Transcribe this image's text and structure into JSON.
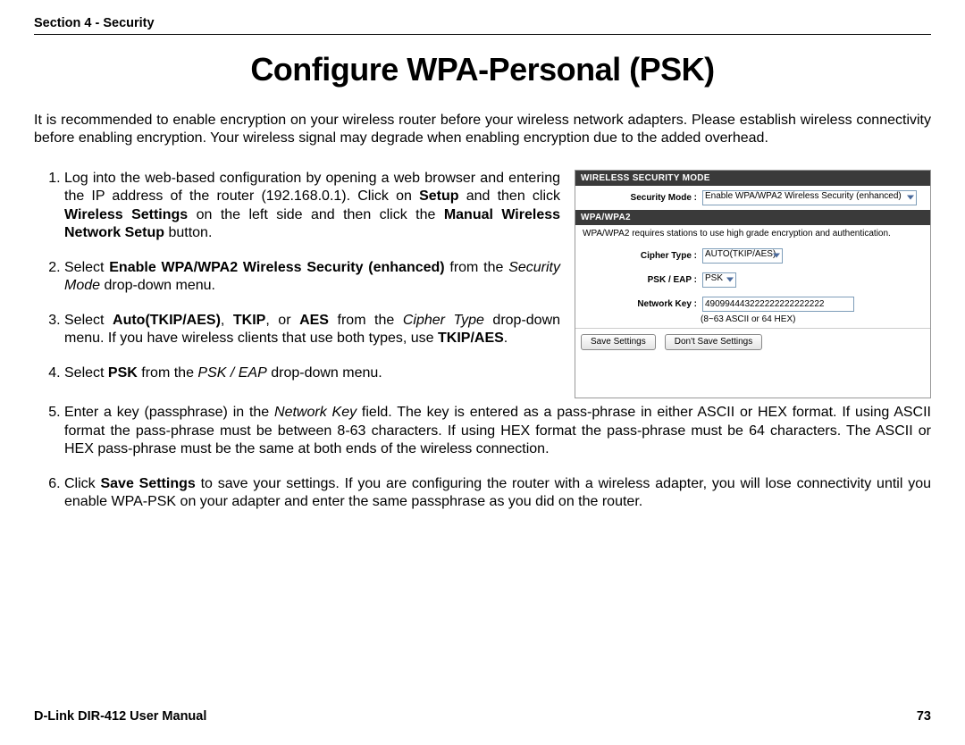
{
  "header": {
    "section": "Section 4 - Security"
  },
  "title": "Configure WPA-Personal (PSK)",
  "intro": "It is recommended to enable encryption on your wireless router before your wireless network adapters. Please establish wireless connectivity before enabling encryption. Your wireless signal may degrade when enabling encryption due to the added overhead.",
  "steps": {
    "s1": {
      "pre": "Log into the web-based configuration by opening a web browser and entering the IP address of the router (192.168.0.1). Click on ",
      "b1": "Setup",
      "mid1": " and then click ",
      "b2": "Wireless Settings",
      "mid2": " on the left side and then click the ",
      "b3": "Manual Wireless Network Setup",
      "post": " button."
    },
    "s2": {
      "pre": "Select ",
      "b1": "Enable WPA/WPA2 Wireless Security (enhanced)",
      "mid1": " from the ",
      "i1": "Security Mode",
      "post": " drop-down menu."
    },
    "s3": {
      "pre": "Select ",
      "b1": "Auto(TKIP/AES)",
      "c1": ", ",
      "b2": "TKIP",
      "c2": ", or ",
      "b3": "AES",
      "mid1": " from the ",
      "i1": "Cipher Type",
      "mid2": " drop-down menu. If you have wireless clients that use both types, use ",
      "b4": "TKIP/AES",
      "post": "."
    },
    "s4": {
      "pre": "Select ",
      "b1": "PSK",
      "mid1": " from the ",
      "i1": "PSK / EAP",
      "post": " drop-down menu."
    },
    "s5": {
      "pre": "Enter a key (passphrase) in the ",
      "i1": "Network Key",
      "post": " field. The key is entered as a pass-phrase in either ASCII or HEX format. If using ASCII format the pass-phrase must be between 8-63 characters.  If using HEX format the pass-phrase must be 64 characters. The ASCII or HEX pass-phrase must be the same at both ends of the wireless connection."
    },
    "s6": {
      "pre": "Click ",
      "b1": "Save Settings",
      "post": " to save your settings. If you are configuring the router with a wireless adapter, you will lose connectivity until you enable WPA-PSK on your adapter and enter the same passphrase as you did on the router."
    }
  },
  "panel": {
    "hdr1": "WIRELESS SECURITY MODE",
    "security_mode_label": "Security Mode :",
    "security_mode_value": "Enable WPA/WPA2 Wireless Security (enhanced)",
    "hdr2": "WPA/WPA2",
    "note": "WPA/WPA2 requires stations to use high grade encryption and authentication.",
    "cipher_label": "Cipher Type :",
    "cipher_value": "AUTO(TKIP/AES)",
    "psk_label": "PSK / EAP :",
    "psk_value": "PSK",
    "netkey_label": "Network Key :",
    "netkey_value": "490994443222222222222222",
    "netkey_hint": "(8~63 ASCII or 64 HEX)",
    "save": "Save Settings",
    "dont_save": "Don't Save Settings"
  },
  "footer": {
    "left": "D-Link DIR-412 User Manual",
    "right": "73"
  }
}
